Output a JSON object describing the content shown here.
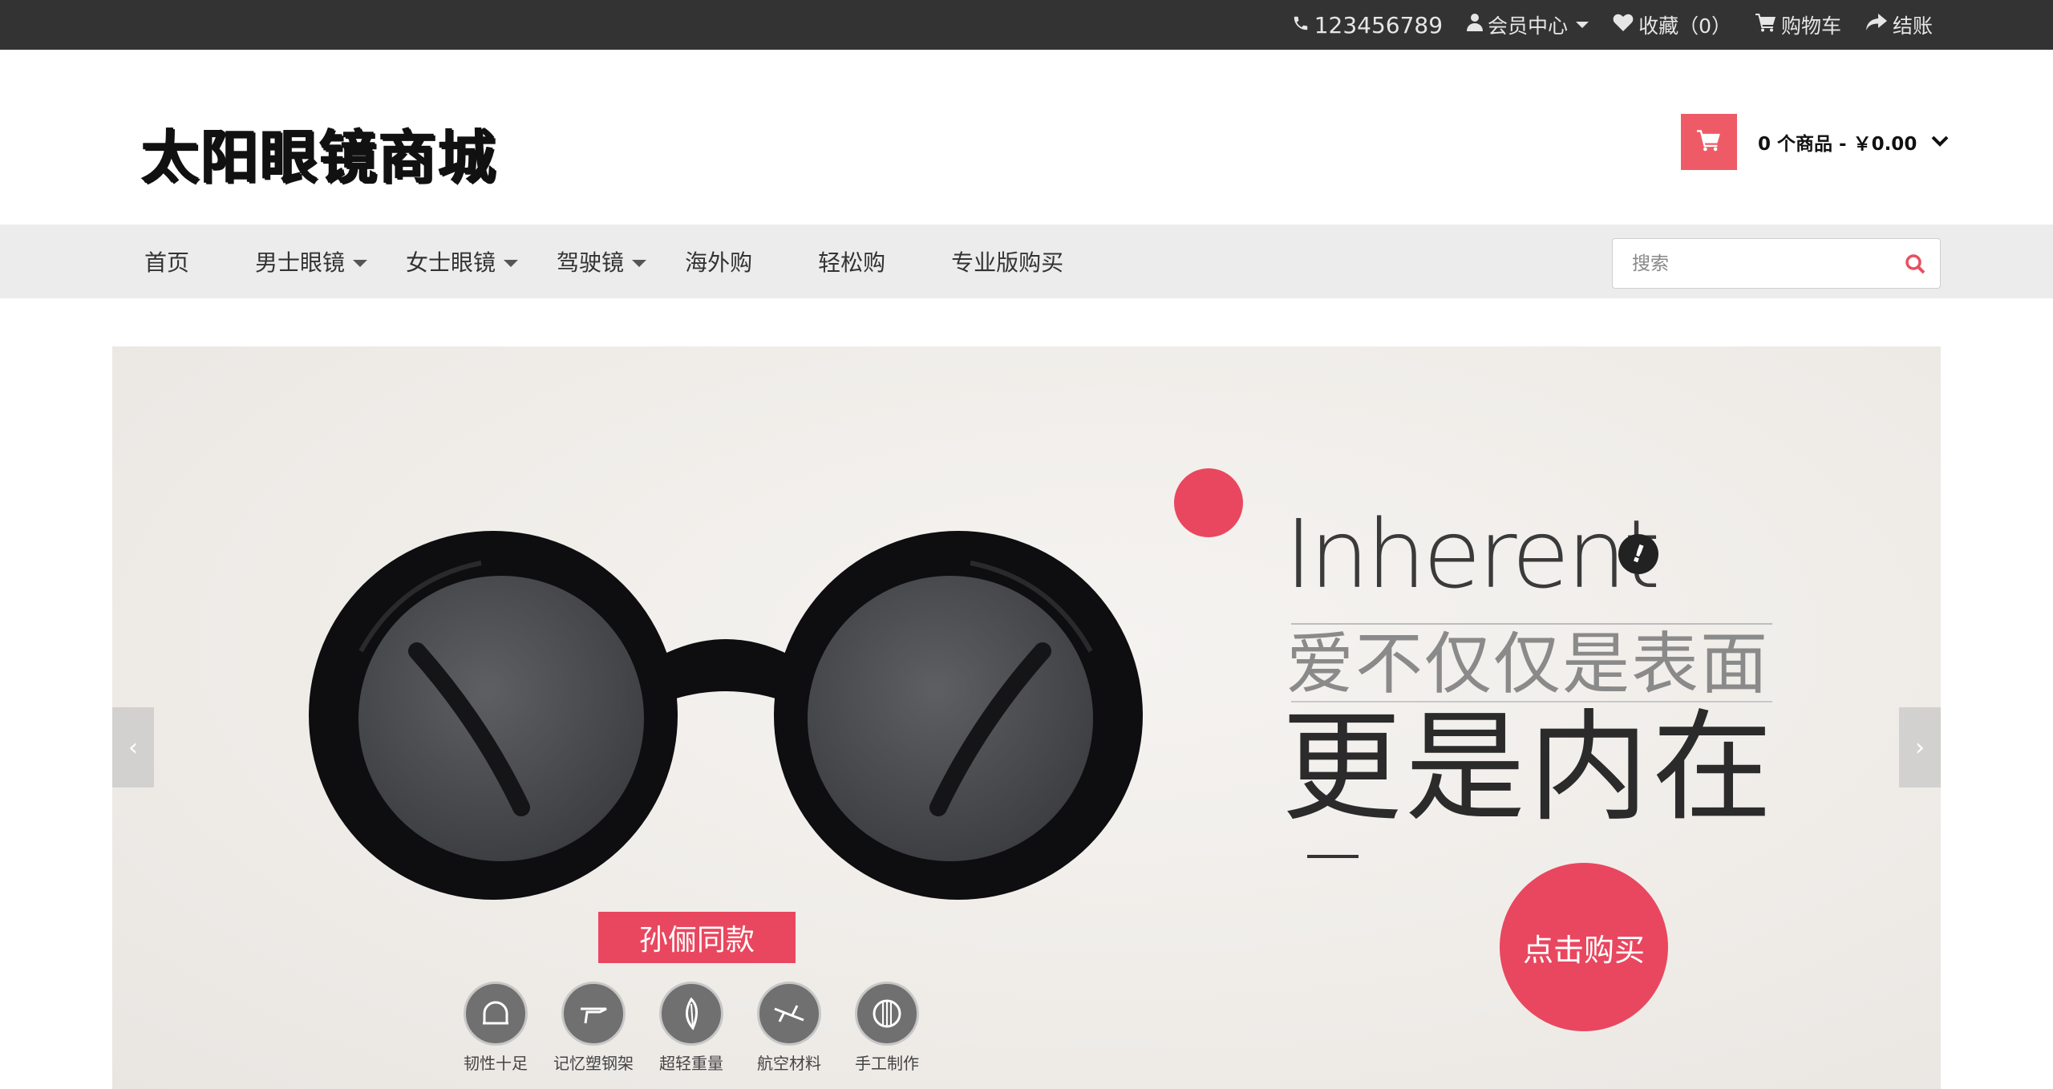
{
  "topbar": {
    "phone": "123456789",
    "account": "会员中心",
    "wishlist": "收藏（0）",
    "cart": "购物车",
    "checkout": "结账"
  },
  "header": {
    "logo": "太阳眼镜商城",
    "cart_summary": "0 个商品 - ￥0.00"
  },
  "nav": {
    "items": [
      {
        "label": "首页",
        "has_dropdown": false
      },
      {
        "label": "男士眼镜",
        "has_dropdown": true
      },
      {
        "label": "女士眼镜",
        "has_dropdown": true
      },
      {
        "label": "驾驶镜",
        "has_dropdown": true
      },
      {
        "label": "海外购",
        "has_dropdown": false
      },
      {
        "label": "轻松购",
        "has_dropdown": false
      },
      {
        "label": "专业版购买",
        "has_dropdown": false
      }
    ],
    "search_placeholder": "搜索"
  },
  "banner": {
    "prev_arrow": "‹",
    "next_arrow": "›",
    "headline": "Inherent",
    "slogan_1": "爱不仅仅是表面",
    "slogan_2": "更是内在",
    "tag": "孙俪同款",
    "cta": "点击购买",
    "features": [
      "韧性十足",
      "记忆塑钢架",
      "超轻重量",
      "航空材料",
      "手工制作"
    ]
  },
  "colors": {
    "topbar_bg": "#333333",
    "accent": "#e9475f",
    "nav_bg": "#ececec"
  }
}
